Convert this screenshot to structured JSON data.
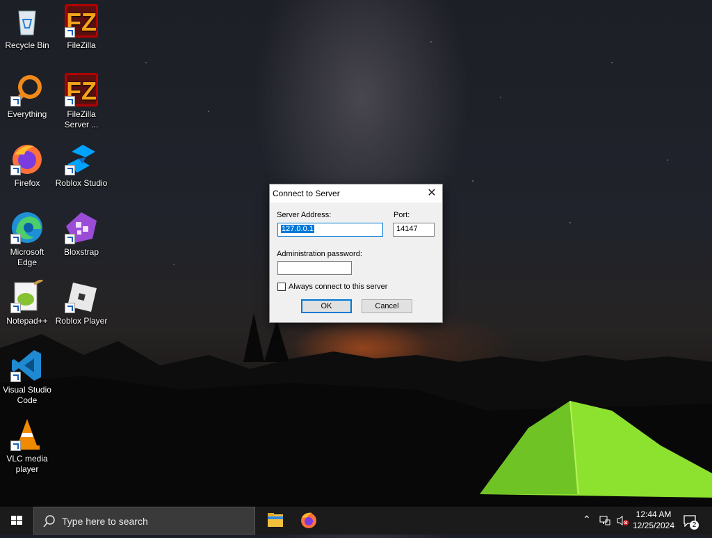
{
  "desktop": {
    "icons": [
      {
        "label": "Recycle Bin"
      },
      {
        "label": "FileZilla"
      },
      {
        "label": "Everything"
      },
      {
        "label": "FileZilla Server ..."
      },
      {
        "label": "Firefox"
      },
      {
        "label": "Roblox Studio"
      },
      {
        "label": "Microsoft Edge"
      },
      {
        "label": "Bloxstrap"
      },
      {
        "label": "Notepad++"
      },
      {
        "label": "Roblox Player"
      },
      {
        "label": "Visual Studio Code"
      },
      {
        "label": "VLC media player"
      }
    ]
  },
  "dialog": {
    "title": "Connect to Server",
    "close_glyph": "✕",
    "server_address_label": "Server Address:",
    "server_address_value": "127.0.0.1",
    "port_label": "Port:",
    "port_value": "14147",
    "password_label": "Administration password:",
    "password_value": "",
    "always_connect_label": "Always connect to this server",
    "always_connect_checked": false,
    "ok_label": "OK",
    "cancel_label": "Cancel"
  },
  "taskbar": {
    "search_placeholder": "Type here to search",
    "time": "12:44 AM",
    "date": "12/25/2024",
    "notification_count": "2",
    "accent_color": "#0078d7"
  }
}
